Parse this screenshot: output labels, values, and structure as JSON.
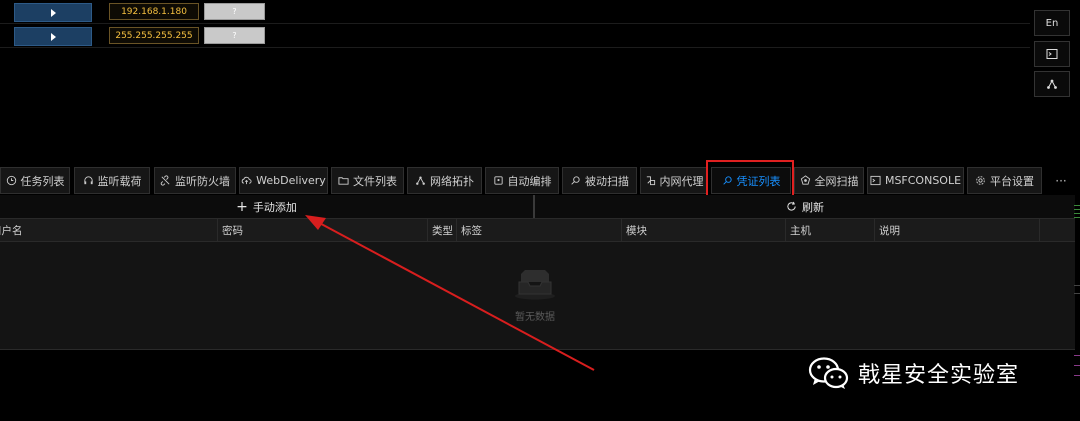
{
  "top_rows": [
    {
      "ip": "192.168.1.180",
      "q": "?"
    },
    {
      "ip": "255.255.255.255",
      "q": "?"
    }
  ],
  "side_buttons": {
    "lang": "En"
  },
  "tabs": [
    {
      "label": "任务列表",
      "icon": "clock-icon"
    },
    {
      "label": "监听载荷",
      "icon": "headphones-icon"
    },
    {
      "label": "监听防火墙",
      "icon": "link-off-icon"
    },
    {
      "label": "WebDelivery",
      "icon": "cloud-upload-icon"
    },
    {
      "label": "文件列表",
      "icon": "folder-icon"
    },
    {
      "label": "网络拓扑",
      "icon": "topology-icon"
    },
    {
      "label": "自动编排",
      "icon": "robot-icon"
    },
    {
      "label": "被动扫描",
      "icon": "search-icon"
    },
    {
      "label": "内网代理",
      "icon": "proxy-icon"
    },
    {
      "label": "凭证列表",
      "icon": "key-search-icon",
      "active": true
    },
    {
      "label": "全网扫描",
      "icon": "global-icon"
    },
    {
      "label": "MSFCONSOLE",
      "icon": "terminal-icon"
    },
    {
      "label": "平台设置",
      "icon": "gear-icon"
    }
  ],
  "more_label": "···",
  "actions": {
    "add": "手动添加",
    "refresh": "刷新"
  },
  "columns": [
    "用户名",
    "密码",
    "类型",
    "标签",
    "模块",
    "主机",
    "说明"
  ],
  "empty_text": "暂无数据",
  "watermark": "戟星安全实验室",
  "colors": {
    "accent": "#1890ff",
    "highlight": "#e02020",
    "ip_text": "#f5c040"
  }
}
